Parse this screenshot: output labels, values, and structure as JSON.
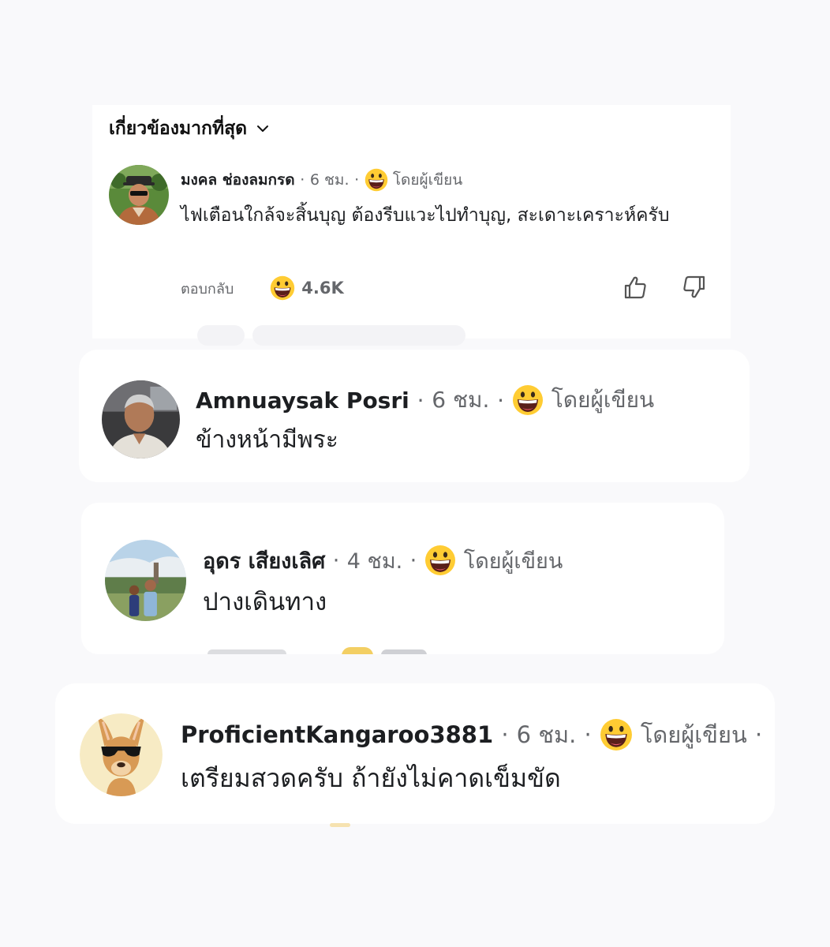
{
  "sort": {
    "label": "เกี่ยวข้องมากที่สุด"
  },
  "comments": [
    {
      "author": "มงคล ช่องลมกรด",
      "time": "6 ชม.",
      "badge": "โดยผู้เขียน",
      "text": "ไฟเตือนใกล้จะสิ้นบุญ ต้องรีบแวะไปทำบุญ, สะเดาะเคราะห์ครับ",
      "reply_label": "ตอบกลับ",
      "reaction_count": "4.6K",
      "reaction_icon": "grinning-face-emoji"
    },
    {
      "author": "Amnuaysak Posri",
      "time": "6 ชม.",
      "badge": "โดยผู้เขียน",
      "text": "ข้างหน้ามีพระ"
    },
    {
      "author": "อุดร เสียงเลิศ",
      "time": "4 ชม.",
      "badge": "โดยผู้เขียน",
      "text": "ปางเดินทาง"
    },
    {
      "author": "ProficientKangaroo3881",
      "time": "6 ชม.",
      "badge": "โดยผู้เขียน",
      "text": "เตรียมสวดครับ ถ้ายังไม่คาดเข็มขัด"
    }
  ],
  "colors": {
    "background": "#f9f9fb",
    "card": "#ffffff",
    "muted_text": "#65676b",
    "emoji_yellow": "#ffcc33"
  }
}
